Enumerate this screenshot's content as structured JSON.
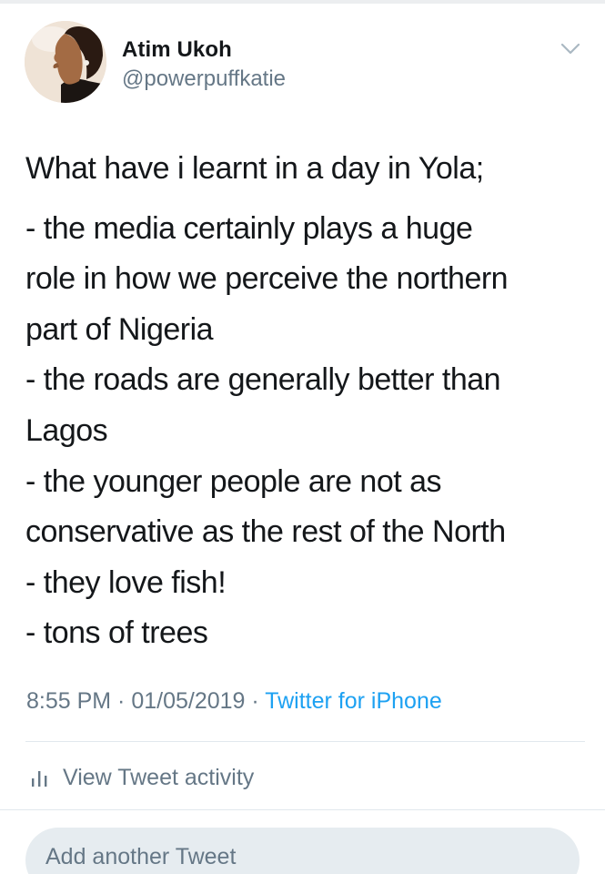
{
  "author": {
    "display_name": "Atim Ukoh",
    "handle": "@powerpuffkatie"
  },
  "tweet": {
    "intro": "What have i learnt in a day in Yola;",
    "lines": [
      "- the media certainly plays a huge",
      "role in how we perceive the northern",
      "part of Nigeria",
      "- the roads are generally better than",
      "Lagos",
      "- the younger people are not as",
      "conservative as the rest of the North",
      "- they love fish!",
      "- tons of trees"
    ],
    "time": "8:55 PM",
    "date": "01/05/2019",
    "separator": " · ",
    "source": "Twitter for iPhone"
  },
  "actions": {
    "view_activity": "View Tweet activity",
    "add_tweet": "Add another Tweet"
  },
  "icons": {
    "menu": "chevron-down-icon",
    "activity": "bar-chart-icon"
  },
  "colors": {
    "text": "#14171a",
    "secondary": "#657786",
    "link": "#1da1f2",
    "divider": "#e1e8ed",
    "pill_bg": "#e6ecf0"
  }
}
